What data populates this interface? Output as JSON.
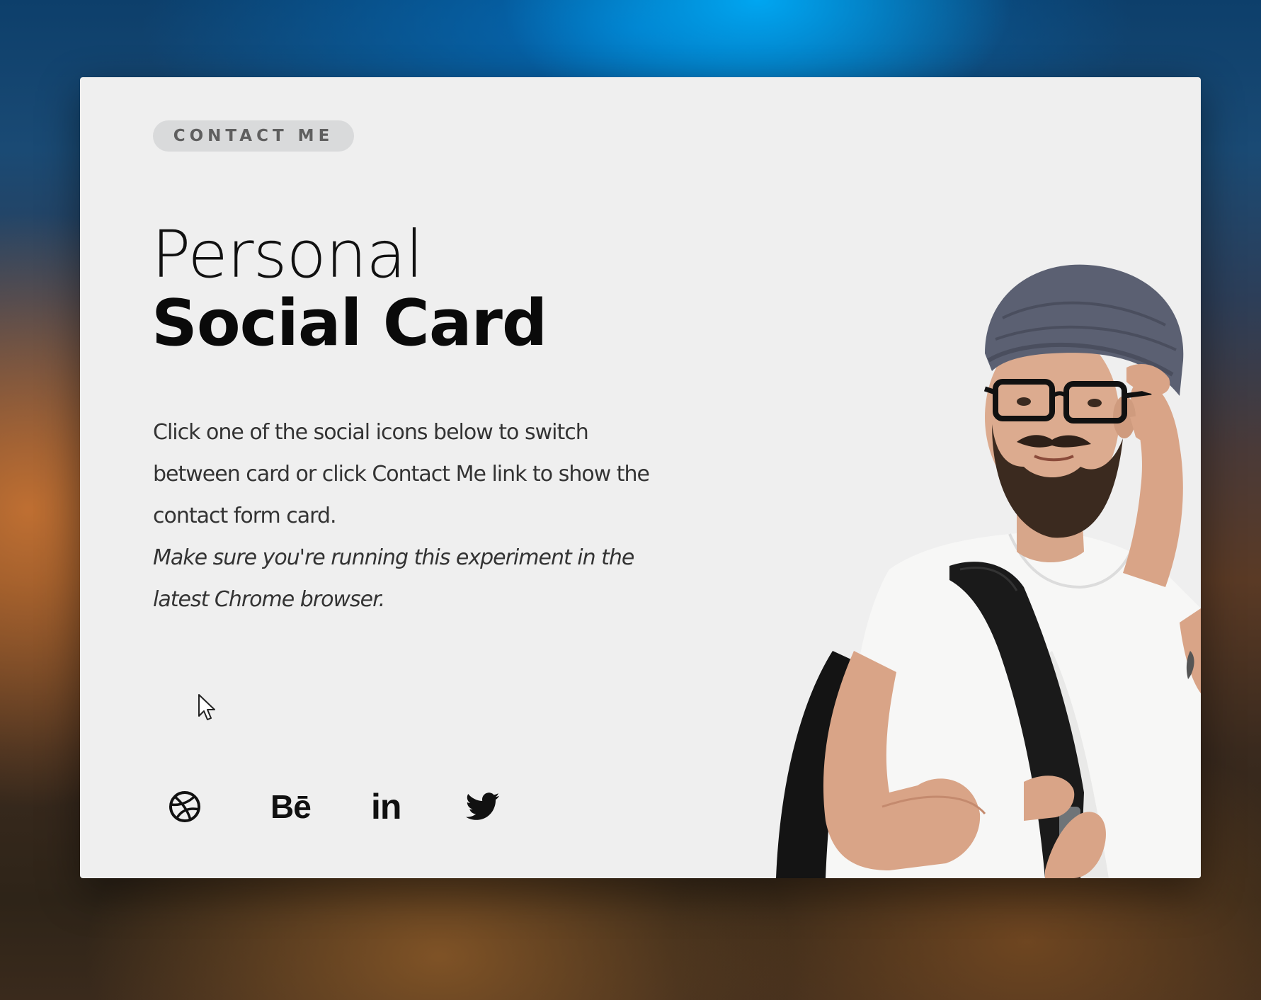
{
  "card": {
    "contact_label": "CONTACT ME",
    "title_light": "Personal",
    "title_bold": "Social Card",
    "description": "Click one of the social icons below to switch between card or click Contact Me link to show the contact form card.",
    "note": "Make sure you're running this experiment in the latest Chrome browser."
  },
  "socials": [
    {
      "icon": "dribbble-icon"
    },
    {
      "icon": "behance-icon",
      "label": "Bē"
    },
    {
      "icon": "linkedin-icon",
      "label": "in"
    },
    {
      "icon": "twitter-icon"
    }
  ],
  "colors": {
    "card_background": "#efefef",
    "pill_background": "#d9dadb",
    "text_dark": "#111111"
  }
}
